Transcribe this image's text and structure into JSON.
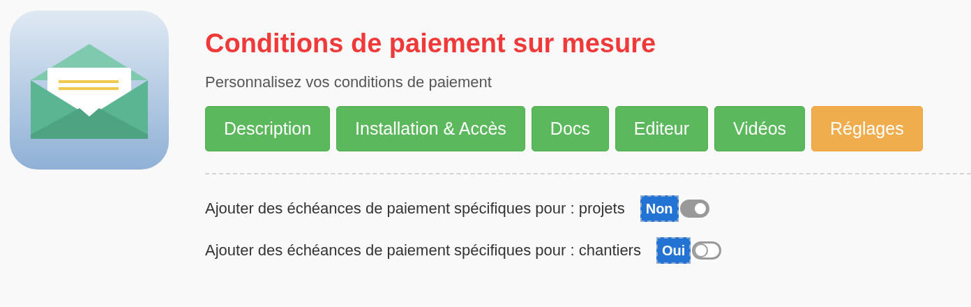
{
  "title": "Conditions de paiement sur mesure",
  "subtitle": "Personnalisez vos conditions de paiement",
  "tabs": [
    {
      "label": "Description",
      "selected": false
    },
    {
      "label": "Installation & Accès",
      "selected": false
    },
    {
      "label": "Docs",
      "selected": false
    },
    {
      "label": "Editeur",
      "selected": false
    },
    {
      "label": "Vidéos",
      "selected": false
    },
    {
      "label": "Réglages",
      "selected": true
    }
  ],
  "settings": [
    {
      "label": "Ajouter des échéances de paiement spécifiques pour : projets",
      "badge": "Non",
      "on": true
    },
    {
      "label": "Ajouter des échéances de paiement spécifiques pour : chantiers",
      "badge": "Oui",
      "on": false
    }
  ]
}
